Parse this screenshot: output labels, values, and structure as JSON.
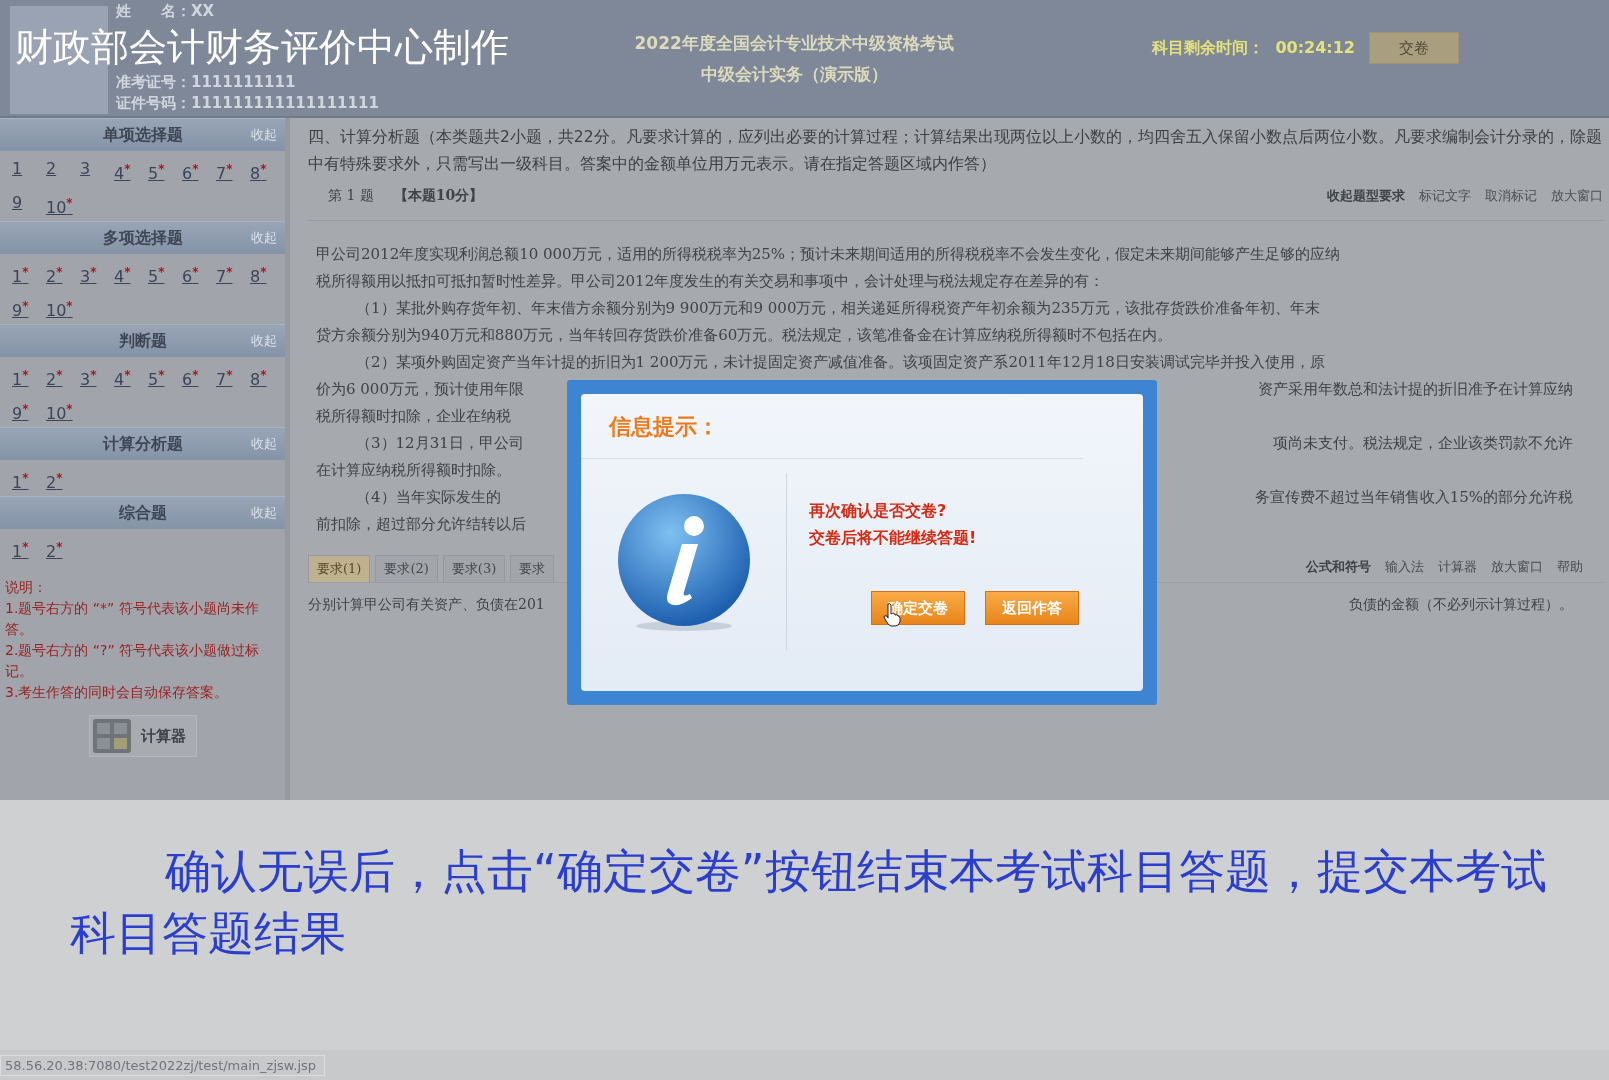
{
  "overlay_title": "财政部会计财务评价中心制作",
  "header": {
    "fields": [
      {
        "label": "姓　　名：",
        "value": "XX"
      },
      {
        "label": "准考证号：",
        "value": "1111111111"
      },
      {
        "label": "证件号码：",
        "value": "111111111111111111"
      }
    ],
    "exam_title": "2022年度全国会计专业技术中级资格考试",
    "subject": "中级会计实务（演示版）",
    "timer_label": "科目剩余时间：",
    "timer": "00:24:12",
    "submit_button": "交卷"
  },
  "sidebar": {
    "sections": [
      {
        "title": "单项选择题",
        "toggle": "收起",
        "items": [
          {
            "label": "1"
          },
          {
            "label": "2"
          },
          {
            "label": "3"
          },
          {
            "label": "4",
            "mark": "*"
          },
          {
            "label": "5",
            "mark": "*"
          },
          {
            "label": "6",
            "mark": "*"
          },
          {
            "label": "7",
            "mark": "*"
          },
          {
            "label": "8",
            "mark": "*"
          },
          {
            "label": "9"
          },
          {
            "label": "10",
            "mark": "*"
          }
        ]
      },
      {
        "title": "多项选择题",
        "toggle": "收起",
        "items": [
          {
            "label": "1",
            "mark": "*"
          },
          {
            "label": "2",
            "mark": "*"
          },
          {
            "label": "3",
            "mark": "*"
          },
          {
            "label": "4",
            "mark": "*"
          },
          {
            "label": "5",
            "mark": "*"
          },
          {
            "label": "6",
            "mark": "*"
          },
          {
            "label": "7",
            "mark": "*"
          },
          {
            "label": "8",
            "mark": "*"
          },
          {
            "label": "9",
            "mark": "*"
          },
          {
            "label": "10",
            "mark": "*"
          }
        ]
      },
      {
        "title": "判断题",
        "toggle": "收起",
        "items": [
          {
            "label": "1",
            "mark": "*"
          },
          {
            "label": "2",
            "mark": "*"
          },
          {
            "label": "3",
            "mark": "*"
          },
          {
            "label": "4",
            "mark": "*"
          },
          {
            "label": "5",
            "mark": "*"
          },
          {
            "label": "6",
            "mark": "*"
          },
          {
            "label": "7",
            "mark": "*"
          },
          {
            "label": "8",
            "mark": "*"
          },
          {
            "label": "9",
            "mark": "*"
          },
          {
            "label": "10",
            "mark": "*"
          }
        ]
      },
      {
        "title": "计算分析题",
        "toggle": "收起",
        "items": [
          {
            "label": "1",
            "mark": "*"
          },
          {
            "label": "2",
            "mark": "*"
          }
        ]
      },
      {
        "title": "综合题",
        "toggle": "收起",
        "items": [
          {
            "label": "1",
            "mark": "*"
          },
          {
            "label": "2",
            "mark": "*"
          }
        ]
      }
    ],
    "notes": [
      "说明：",
      "1.题号右方的 “*” 符号代表该小题尚未作答。",
      "2.题号右方的 “?” 符号代表该小题做过标记。",
      "3.考生作答的同时会自动保存答案。"
    ],
    "calculator_button": "计算器"
  },
  "main": {
    "instructions": "四、计算分析题（本类题共2小题，共22分。凡要求计算的，应列出必要的计算过程；计算结果出现两位以上小数的，均四舍五入保留小数点后两位小数。凡要求编制会计分录的，除题中有特殊要求外，只需写出一级科目。答案中的金额单位用万元表示。请在指定答题区域内作答）",
    "question_number": "第 1 题",
    "question_points": "【本题10分】",
    "tools": [
      "收起题型要求",
      "标记文字",
      "取消标记",
      "放大窗口"
    ],
    "body": [
      {
        "left": "甲公司2012年度实现利润总额10 000万元，适用的所得税税率为25%；预计未来期间适用的所得税税率不会发生变化，假定未来期间能够产生足够的应纳",
        "indent": false
      },
      {
        "left": "税所得额用以抵扣可抵扣暂时性差异。甲公司2012年度发生的有关交易和事项中，会计处理与税法规定存在差异的有：",
        "indent": false
      },
      {
        "left": "（1）某批外购存货年初、年末借方余额分别为9 900万元和9 000万元，相关递延所得税资产年初余额为235万元，该批存货跌价准备年初、年末",
        "indent": true
      },
      {
        "left": "贷方余额分别为940万元和880万元，当年转回存货跌价准备60万元。税法规定，该笔准备金在计算应纳税所得额时不包括在内。",
        "indent": false
      },
      {
        "left": "（2）某项外购固定资产当年计提的折旧为1 200万元，未计提固定资产减值准备。该项固定资产系2011年12月18日安装调试完毕并投入使用，原",
        "indent": true
      },
      {
        "left": "价为6 000万元，预计使用年限",
        "right": "资产采用年数总和法计提的折旧准予在计算应纳",
        "indent": false
      },
      {
        "left": "税所得额时扣除，企业在纳税",
        "indent": false
      },
      {
        "left": "（3）12月31日，甲公司",
        "right": "项尚未支付。税法规定，企业该类罚款不允许",
        "indent": true
      },
      {
        "left": "在计算应纳税所得额时扣除。",
        "indent": false
      },
      {
        "left": "（4）当年实际发生的",
        "right": "务宣传费不超过当年销售收入15%的部分允许税",
        "indent": true
      },
      {
        "left": "前扣除，超过部分允许结转以后",
        "indent": false
      }
    ],
    "tabs": [
      {
        "label": "要求(1)",
        "selected": true
      },
      {
        "label": "要求(2)",
        "selected": false
      },
      {
        "label": "要求(3)",
        "selected": false
      },
      {
        "label": "要求",
        "selected": false
      }
    ],
    "answer_tools": [
      "公式和符号",
      "输入法",
      "计算器",
      "放大窗口",
      "帮助"
    ],
    "requirement_left": "分别计算甲公司有关资产、负债在201",
    "requirement_right": "负债的金额（不必列示计算过程）。"
  },
  "dialog": {
    "title": "信息提示：",
    "messages": [
      "再次确认是否交卷?",
      "交卷后将不能继续答题!"
    ],
    "buttons": [
      "确定交卷",
      "返回作答"
    ]
  },
  "caption": "确认无误后，点击“确定交卷”按钮结束本考试科目答题，提交本考试科目答题结果",
  "status_bar": "58.56.20.38:7080/test2022zj/test/main_zjsw.jsp"
}
